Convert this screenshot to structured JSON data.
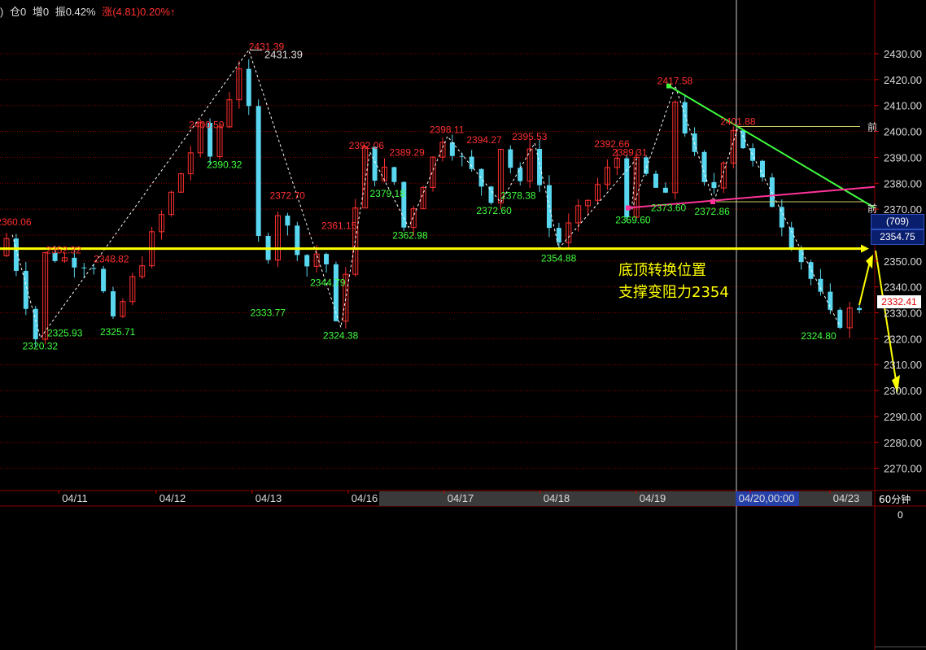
{
  "header": {
    "paren": ")",
    "position": "仓0",
    "increase": "增0",
    "amplitude": "振0.42%",
    "change": "涨(4.81)0.20%↑"
  },
  "colors": {
    "up": "#ff3030",
    "down": "#5ad7f0",
    "grid": "#8b0000",
    "axis": "#8b0000",
    "zigzag": "#ffffff",
    "support_line": "#ffff00",
    "green_line": "#40ff40",
    "pink_line": "#ff3399",
    "label_high": "#ff3030",
    "label_low": "#40ff40"
  },
  "annotation": {
    "line1": "底顶转换位置",
    "line2": "支撑变阻力2354"
  },
  "price_boxes": {
    "count": "(709)",
    "level": "2354.75",
    "current": "2332.41"
  },
  "period_label": "60分钟",
  "sub_axis_label": "0",
  "crosshair_label": "04/20,00:00",
  "ref_label": "前",
  "chart_data": {
    "type": "candlestick",
    "title": "",
    "xlabel": "",
    "ylabel": "",
    "ylim": [
      2262,
      2442
    ],
    "y_ticks": [
      2430,
      2420,
      2410,
      2400,
      2390,
      2380,
      2370,
      2360,
      2350,
      2340,
      2330,
      2320,
      2310,
      2300,
      2290,
      2280,
      2270
    ],
    "y_tick_labels": [
      "2430.00",
      "2420.00",
      "2410.00",
      "2400.00",
      "2390.00",
      "2380.00",
      "2370.00",
      "2360.00",
      "2350.00",
      "2340.00",
      "2330.00",
      "2320.00",
      "2310.00",
      "2300.00",
      "2290.00",
      "2280.00",
      "2270.00"
    ],
    "x_labels": [
      "04/11",
      "04/12",
      "04/13",
      "04/16",
      "04/17",
      "04/18",
      "04/19",
      "04/20,00:00",
      "04/23"
    ],
    "swing_points": [
      {
        "label": "2360.06",
        "type": "high",
        "x": 0.6,
        "y": 2360.06
      },
      {
        "label": "2320.32",
        "type": "low",
        "x": 3.5,
        "y": 2320.32
      },
      {
        "label": "2325.93",
        "type": "low",
        "x": 4.0,
        "y": 2325.93
      },
      {
        "label": "2352.32",
        "type": "high",
        "x": 4.4,
        "y": 2352.32
      },
      {
        "label": "2348.82",
        "type": "high",
        "x": 9.5,
        "y": 2348.82
      },
      {
        "label": "2325.71",
        "type": "low",
        "x": 11.5,
        "y": 2325.71
      },
      {
        "label": "2400.59",
        "type": "high",
        "x": 20.5,
        "y": 2400.59
      },
      {
        "label": "2390.32",
        "type": "low",
        "x": 21.5,
        "y": 2390.32
      },
      {
        "label": "2431.39",
        "type": "high",
        "x": 25.0,
        "y": 2431.39
      },
      {
        "label": "2372.70",
        "type": "high",
        "x": 28.0,
        "y": 2372.7
      },
      {
        "label": "2333.77",
        "type": "low",
        "x": 27.0,
        "y": 2333.77
      },
      {
        "label": "2361.15",
        "type": "high",
        "x": 33.0,
        "y": 2361.15
      },
      {
        "label": "2344.79",
        "type": "low",
        "x": 32.0,
        "y": 2344.79
      },
      {
        "label": "2324.38",
        "type": "low",
        "x": 34.5,
        "y": 2324.38
      },
      {
        "label": "2392.06",
        "type": "high",
        "x": 37.5,
        "y": 2392.06
      },
      {
        "label": "2389.29",
        "type": "high",
        "x": 40.0,
        "y": 2389.29
      },
      {
        "label": "2379.18",
        "type": "low",
        "x": 39.0,
        "y": 2379.18
      },
      {
        "label": "2362.98",
        "type": "low",
        "x": 41.5,
        "y": 2362.98
      },
      {
        "label": "2398.11",
        "type": "high",
        "x": 45.5,
        "y": 2398.11
      },
      {
        "label": "2372.60",
        "type": "low",
        "x": 51.0,
        "y": 2372.6
      },
      {
        "label": "2394.27",
        "type": "high",
        "x": 51.5,
        "y": 2394.27
      },
      {
        "label": "2395.53",
        "type": "high",
        "x": 54.5,
        "y": 2395.53
      },
      {
        "label": "2378.38",
        "type": "low",
        "x": 53.5,
        "y": 2378.38
      },
      {
        "label": "2354.88",
        "type": "low",
        "x": 57.0,
        "y": 2354.88
      },
      {
        "label": "2392.66",
        "type": "high",
        "x": 64.0,
        "y": 2392.66
      },
      {
        "label": "2389.31",
        "type": "high",
        "x": 65.0,
        "y": 2389.31
      },
      {
        "label": "2369.60",
        "type": "low",
        "x": 64.5,
        "y": 2369.6
      },
      {
        "label": "2373.60",
        "type": "low",
        "x": 68.5,
        "y": 2373.6
      },
      {
        "label": "2417.58",
        "type": "high",
        "x": 69.0,
        "y": 2417.58
      },
      {
        "label": "2372.86",
        "type": "low",
        "x": 73.0,
        "y": 2372.86
      },
      {
        "label": "2401.88",
        "type": "high",
        "x": 75.5,
        "y": 2401.88
      },
      {
        "label": "2324.80",
        "type": "low",
        "x": 86.0,
        "y": 2324.8
      }
    ],
    "series": []
  }
}
